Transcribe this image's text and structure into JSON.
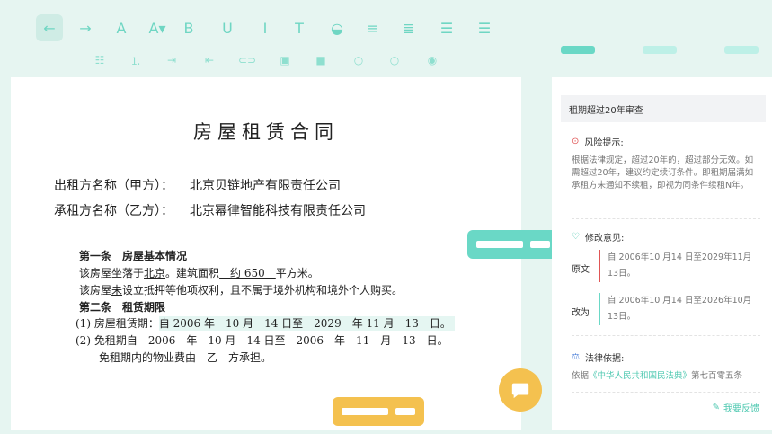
{
  "colors": {
    "accent": "#6ad8c6",
    "warn": "#e05555",
    "gold": "#f4c14f",
    "bg": "#e6f5f1"
  },
  "toolbar": {
    "row1": [
      {
        "name": "undo-arrow-icon",
        "glyph": "←"
      },
      {
        "name": "redo-arrow-icon",
        "glyph": "→"
      },
      {
        "name": "font-color-icon",
        "glyph": "A"
      },
      {
        "name": "font-size-icon",
        "glyph": "A▾"
      },
      {
        "name": "bold-icon",
        "glyph": "B"
      },
      {
        "name": "underline-icon",
        "glyph": "U"
      },
      {
        "name": "italic-icon",
        "glyph": "I"
      },
      {
        "name": "strikethrough-icon",
        "glyph": "T"
      },
      {
        "name": "fill-color-icon",
        "glyph": "◒"
      },
      {
        "name": "align-center-icon",
        "glyph": "≡"
      },
      {
        "name": "align-justify-icon",
        "glyph": "≣"
      },
      {
        "name": "align-left-icon",
        "glyph": "☰"
      },
      {
        "name": "align-right-icon",
        "glyph": "☰"
      }
    ],
    "row2": [
      {
        "name": "bullet-list-icon",
        "glyph": "☷"
      },
      {
        "name": "numbered-list-icon",
        "glyph": "⒈"
      },
      {
        "name": "indent-increase-icon",
        "glyph": "⇥"
      },
      {
        "name": "indent-decrease-icon",
        "glyph": "⇤"
      },
      {
        "name": "link-icon",
        "glyph": "⊂⊃"
      },
      {
        "name": "image-icon",
        "glyph": "▣"
      },
      {
        "name": "video-icon",
        "glyph": "■"
      },
      {
        "name": "circle-icon",
        "glyph": "○"
      },
      {
        "name": "circle-outline-icon",
        "glyph": "○"
      },
      {
        "name": "toggle-icon",
        "glyph": "◉"
      }
    ]
  },
  "document": {
    "title": "房屋租赁合同",
    "lessor_label": "出租方名称（甲方）：",
    "lessor_value": "北京贝链地产有限责任公司",
    "lessee_label": "承租方名称（乙方）：",
    "lessee_value": "北京幂律智能科技有限责任公司",
    "clauses": {
      "c1_title": "第一条　房屋基本情况",
      "c1_l1_a": "该房屋坐落于",
      "c1_l1_b": "北京",
      "c1_l1_c": "。建筑面积",
      "c1_l1_d": "　约 650　",
      "c1_l1_e": "平方米。",
      "c1_l2_a": "该房屋",
      "c1_l2_b": "未",
      "c1_l2_c": "设立抵押等他项权利，且不属于境外机构和境外个人购买。",
      "c2_title": "第二条　租赁期限",
      "c2_l1_a": "(1) 房屋租赁期：",
      "c2_l1_b": "自 2006 年　10 月　14 日至　2029　年 11 月　13　日。",
      "c2_l2": "(2) 免租期自　2006　年　10 月　14 日至　2006　年　11　月　13　日。",
      "c2_l3": "免租期内的物业费由　乙　方承担。"
    }
  },
  "panel": {
    "header": "租期超过20年审查",
    "risk_title": "风险提示:",
    "risk_text": "根据法律规定，超过20年的，超过部分无效。如需超过20年，建议约定续订条件。即租期届满如承租方未通知不续租，即视为同条件续租N年。",
    "suggest_title": "修改意见:",
    "original_label": "原文",
    "original_text": "自 2006年10 月14 日至2029年11月13日。",
    "change_label": "改为",
    "change_text": "自 2006年10 月14 日至2026年10月13日。",
    "law_title": "法律依据:",
    "law_prefix": "依据",
    "law_link": "《中华人民共和国民法典》",
    "law_suffix": "第七百零五条",
    "feedback": "我要反馈"
  }
}
